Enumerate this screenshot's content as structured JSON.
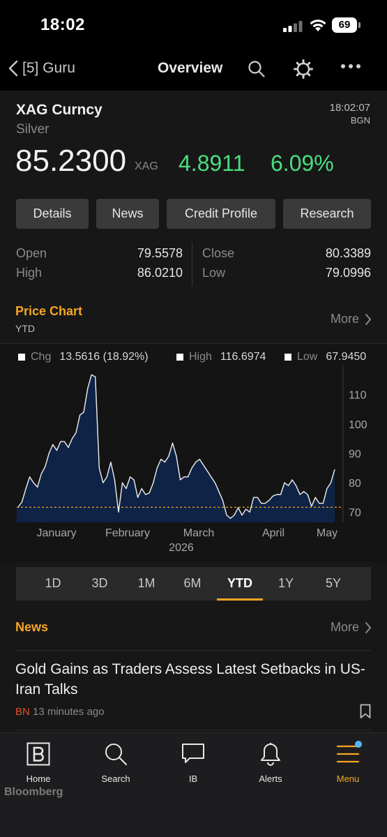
{
  "status": {
    "time": "18:02",
    "battery": "69"
  },
  "nav": {
    "back_label": "[5] Guru",
    "title": "Overview"
  },
  "security": {
    "ticker": "XAG Curncy",
    "name": "Silver",
    "time": "18:02:07",
    "source": "BGN",
    "price": "85.2300",
    "unit": "XAG",
    "change": "4.8911",
    "change_pct": "6.09%",
    "change_color": "#4ade80"
  },
  "actions": [
    "Details",
    "News",
    "Credit Profile",
    "Research"
  ],
  "stats": {
    "open_label": "Open",
    "open": "79.5578",
    "high_label": "High",
    "high": "86.0210",
    "close_label": "Close",
    "close": "80.3389",
    "low_label": "Low",
    "low": "79.0996"
  },
  "price_chart": {
    "title": "Price Chart",
    "subtitle": "YTD",
    "more": "More",
    "legend": {
      "chg_label": "Chg",
      "chg_value": "13.5616 (18.92%)",
      "high_label": "High",
      "high_value": "116.6974",
      "low_label": "Low",
      "low_value": "67.9450"
    }
  },
  "chart_data": {
    "type": "area",
    "x_labels": [
      "January",
      "February",
      "March",
      "April",
      "May"
    ],
    "x_year": "2026",
    "y_ticks": [
      110,
      100,
      90,
      80,
      70
    ],
    "ylim": [
      66.5,
      117.5
    ],
    "baseline": 71.66,
    "series": [
      {
        "values": [
          71.7,
          73.5,
          78,
          82,
          80,
          78.5,
          83,
          85.5,
          90,
          93,
          91,
          94,
          94,
          92,
          95,
          97,
          103,
          104,
          112,
          116.7,
          116,
          85,
          80,
          82,
          87,
          81,
          70,
          80,
          78,
          82,
          81,
          75,
          78,
          76,
          76.5,
          80,
          85,
          88,
          87,
          89,
          93.5,
          89,
          81,
          82,
          82,
          85,
          87,
          88,
          86,
          84,
          82,
          80,
          77,
          74,
          69,
          67.9,
          69,
          71.5,
          69,
          71,
          70,
          75,
          75,
          73,
          73,
          74,
          75.5,
          76,
          76,
          80,
          79,
          81,
          79,
          76,
          77,
          76,
          72,
          75,
          73,
          73,
          78,
          80,
          84.5
        ]
      }
    ],
    "fill_color": "#0f2347",
    "line_color": "#f0f0f0",
    "baseline_color": "#f5a623",
    "grid": false
  },
  "ranges": {
    "items": [
      "1D",
      "3D",
      "1M",
      "6M",
      "YTD",
      "1Y",
      "5Y"
    ],
    "active": "YTD"
  },
  "news": {
    "title": "News",
    "more": "More",
    "headline": "Gold Gains as Traders Assess Latest Setbacks in US-Iran Talks",
    "source": "BN",
    "time": "13 minutes ago"
  },
  "tabbar": {
    "items": [
      "Home",
      "Search",
      "IB",
      "Alerts",
      "Menu"
    ],
    "active": "Menu",
    "brand": "Bloomberg"
  },
  "colors": {
    "accent": "#f5a623",
    "positive": "#4ade80",
    "background": "#171717"
  }
}
